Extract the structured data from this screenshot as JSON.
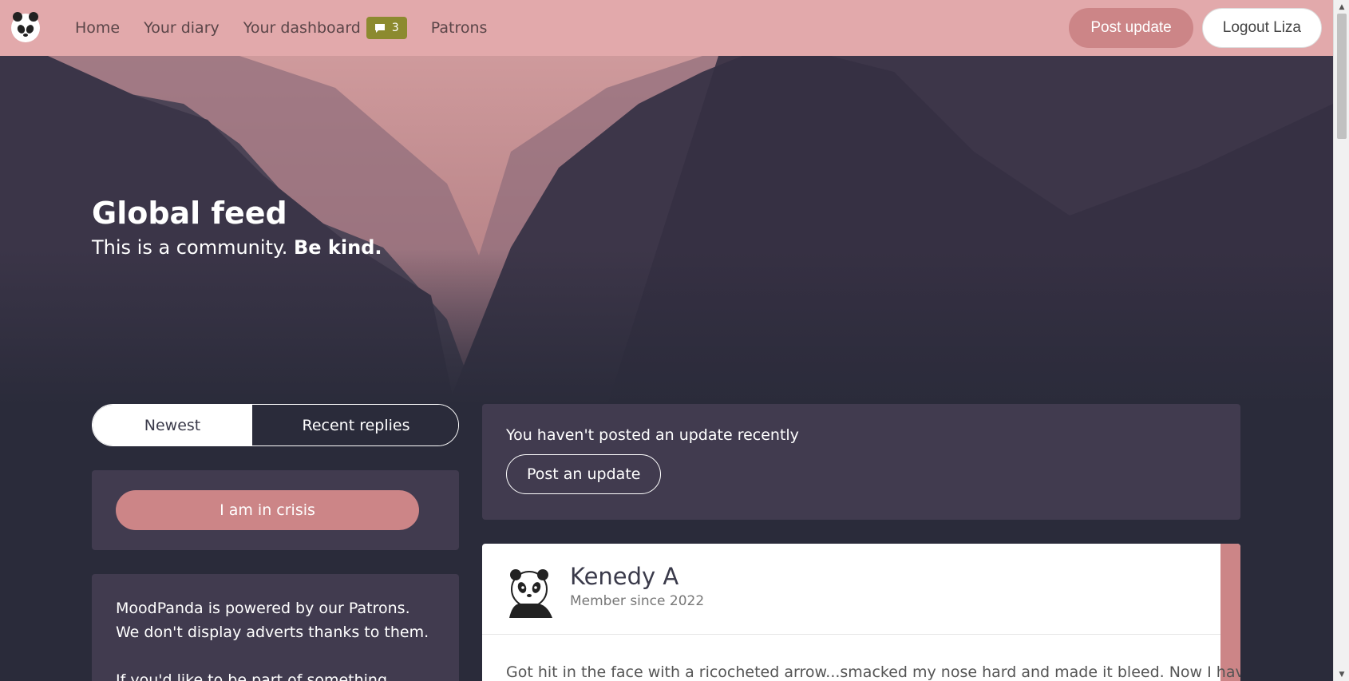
{
  "nav": {
    "home": "Home",
    "diary": "Your diary",
    "dashboard": "Your dashboard",
    "dashboard_badge": "3",
    "patrons": "Patrons",
    "post_update": "Post update",
    "logout": "Logout Liza"
  },
  "hero": {
    "title": "Global feed",
    "subtitle_plain": "This is a community.",
    "subtitle_bold": "Be kind."
  },
  "feed_toggle": {
    "newest": "Newest",
    "recent_replies": "Recent replies",
    "selected": "Recent replies"
  },
  "crisis": {
    "button": "I am in crisis"
  },
  "patron_box": {
    "line1": "MoodPanda is powered by our Patrons.",
    "line2": "We don't display adverts thanks to them.",
    "line3": "If you'd like to be part of something"
  },
  "notice": {
    "text": "You haven't posted an update recently",
    "button": "Post an update"
  },
  "post": {
    "author": "Kenedy A",
    "member_since": "Member since 2022",
    "body": "Got hit in the face with a ricocheted arrow...smacked my nose hard and made it bleed. Now I have"
  },
  "colors": {
    "navbar": "#e2a9ab",
    "accent": "#cc8587",
    "badge": "#8c8a2f",
    "background": "#2a2b3a",
    "card": "#413b4f"
  },
  "icons": {
    "logo": "panda-logo-icon",
    "badge": "chat-bubble-icon",
    "avatar": "panda-avatar-icon"
  }
}
